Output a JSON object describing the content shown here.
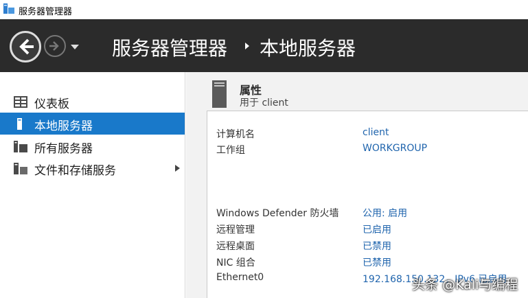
{
  "window": {
    "title": "服务器管理器"
  },
  "header": {
    "breadcrumb_root": "服务器管理器",
    "breadcrumb_current": "本地服务器"
  },
  "sidebar": {
    "items": [
      {
        "label": "仪表板",
        "icon": "dashboard-icon",
        "active": false
      },
      {
        "label": "本地服务器",
        "icon": "server-icon",
        "active": true
      },
      {
        "label": "所有服务器",
        "icon": "servers-icon",
        "active": false
      },
      {
        "label": "文件和存储服务",
        "icon": "storage-icon",
        "active": false,
        "has_submenu": true
      }
    ]
  },
  "section": {
    "title": "属性",
    "subtitle": "用于 client"
  },
  "properties": [
    {
      "label": "计算机名",
      "value": "client"
    },
    {
      "label": "工作组",
      "value": "WORKGROUP"
    },
    {
      "label": "Windows Defender 防火墙",
      "value": "公用: 启用"
    },
    {
      "label": "远程管理",
      "value": "已启用"
    },
    {
      "label": "远程桌面",
      "value": "已禁用"
    },
    {
      "label": "NIC 组合",
      "value": "已禁用"
    },
    {
      "label": "Ethernet0",
      "value": "192.168.150.132，IPv6 已启用"
    }
  ],
  "watermark": "头条 @Kali与编程",
  "colors": {
    "header_bg": "#2b2b2b",
    "accent": "#1979ca",
    "link": "#1f64ad"
  }
}
